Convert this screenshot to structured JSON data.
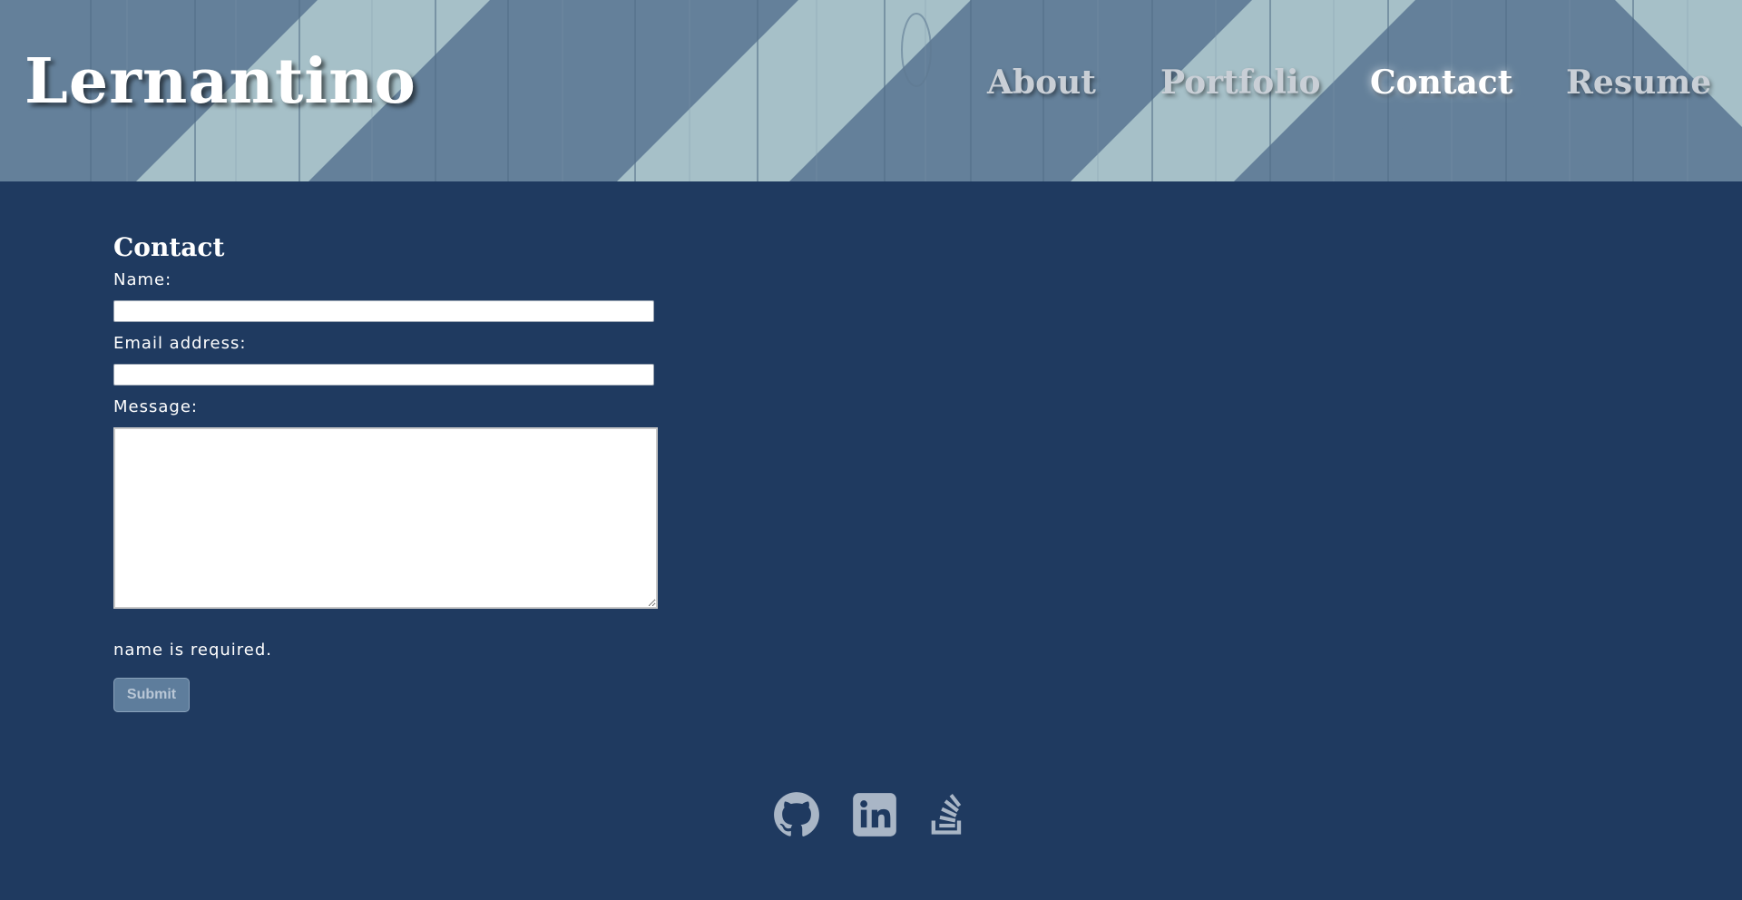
{
  "header": {
    "logo": "Lernantino",
    "nav": [
      {
        "label": "About",
        "active": false
      },
      {
        "label": "Portfolio",
        "active": false
      },
      {
        "label": "Contact",
        "active": true
      },
      {
        "label": "Resume",
        "active": false
      }
    ]
  },
  "contact": {
    "title": "Contact",
    "name_label": "Name:",
    "name_value": "",
    "email_label": "Email address:",
    "email_value": "",
    "message_label": "Message:",
    "message_value": "",
    "error_message": "name is required.",
    "submit_label": "Submit"
  },
  "footer": {
    "icons": [
      "github-icon",
      "linkedin-icon",
      "stack-overflow-icon"
    ]
  },
  "colors": {
    "page_background": "#1f3a60",
    "header_dark": "#64809a",
    "header_light": "#a6c0c8",
    "button": "#5e7d9c",
    "icon_color": "#a9b6c6"
  }
}
